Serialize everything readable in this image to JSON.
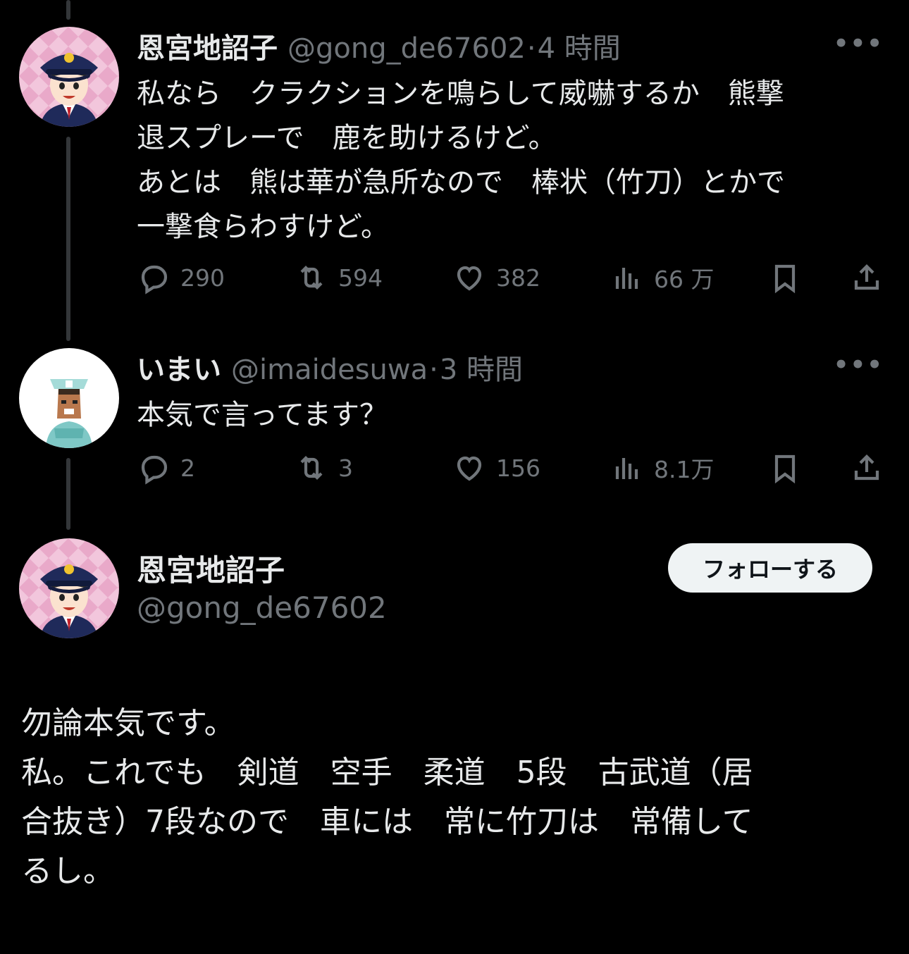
{
  "thread": [
    {
      "author": {
        "name": "恩宮地詔子",
        "handle": "@gong_de67602"
      },
      "separator": "·",
      "time": "4 時間",
      "more": "•••",
      "body_lines": [
        "私なら　クラクションを鳴らして威嚇するか　熊撃",
        "退スプレーで　鹿を助けるけど。",
        "あとは　熊は華が急所なので　棒状（竹刀）とかで",
        "一撃食らわすけど。"
      ],
      "stats": {
        "replies": "290",
        "retweets": "594",
        "likes": "382",
        "views": "66 万"
      }
    },
    {
      "author": {
        "name": "いまい",
        "handle": "@imaidesuwa"
      },
      "separator": "·",
      "time": "3 時間",
      "more": "•••",
      "body_lines": [
        "本気で言ってます？"
      ],
      "stats": {
        "replies": "2",
        "retweets": "3",
        "likes": "156",
        "views": "8.1万"
      }
    }
  ],
  "focus": {
    "author": {
      "name": "恩宮地詔子",
      "handle": "@gong_de67602"
    },
    "follow_label": "フォローする",
    "body_lines": [
      "勿論本気です。",
      "私。これでも　剣道　空手　柔道　5段　古武道（居",
      "合抜き）7段なので　車には　常に竹刀は　常備して",
      "るし。"
    ]
  },
  "icons": {
    "reply": "reply-icon",
    "retweet": "retweet-icon",
    "like": "heart-icon",
    "views": "views-icon",
    "bookmark": "bookmark-icon",
    "share": "share-icon"
  },
  "colors": {
    "background": "#000000",
    "text": "#e7e9ea",
    "muted": "#71767b",
    "button": "#eff3f4"
  }
}
